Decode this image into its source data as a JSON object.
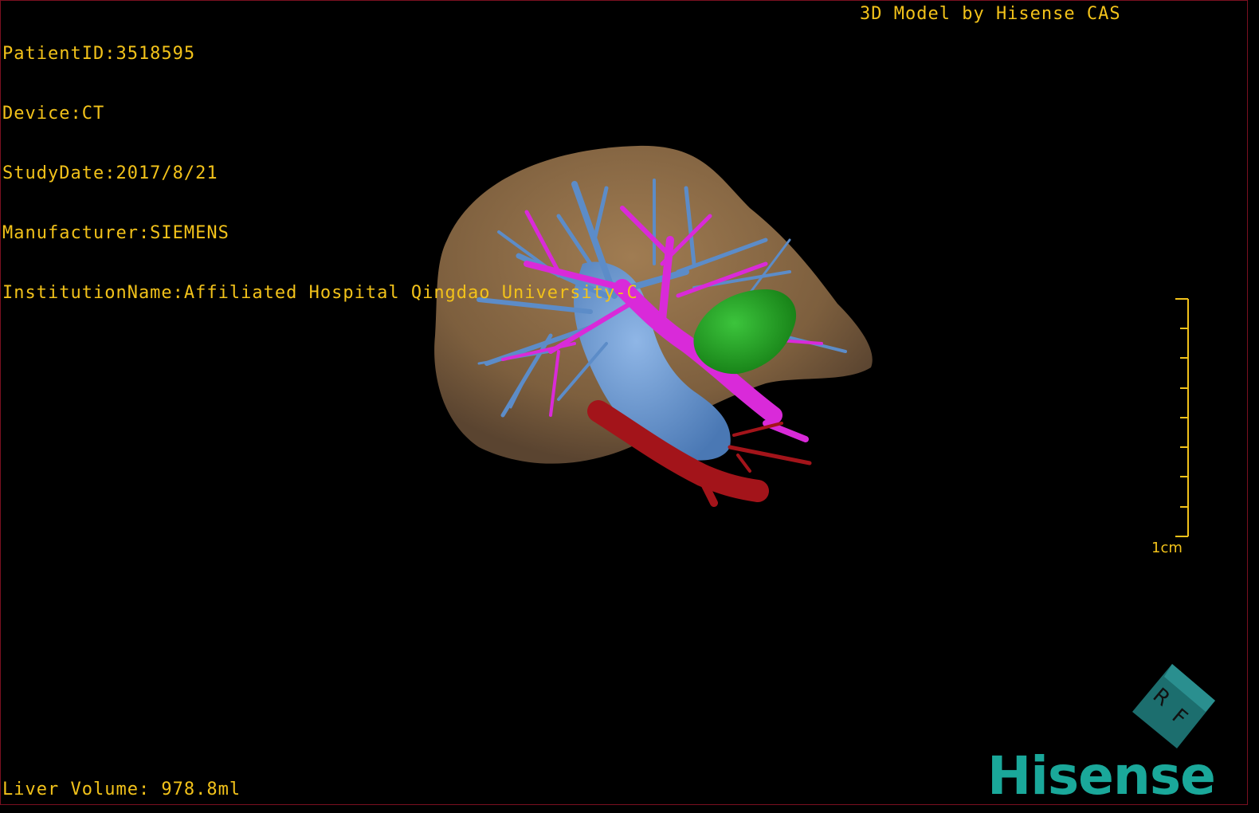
{
  "viewer": {
    "patient_id": "PatientID:3518595",
    "device": "Device:CT",
    "study_date": "StudyDate:2017/8/21",
    "manufacturer": "Manufacturer:SIEMENS",
    "institution": "InstitutionName:Affiliated Hospital Qingdao University-C",
    "model_title": "3D Model by Hisense CAS",
    "liver_volume": "Liver Volume: 978.8ml",
    "scale_label": "1cm",
    "orientation_letter_1": "R",
    "orientation_letter_2": "F",
    "brand": "Hisense"
  },
  "colors": {
    "text": "#f2c21a",
    "liver": "#8a6a45",
    "hepatic_vein": "#5c8cc8",
    "portal_vein": "#d92ad9",
    "tumor": "#2aa32a",
    "artery": "#a3141a",
    "brand": "#1aa89a"
  }
}
